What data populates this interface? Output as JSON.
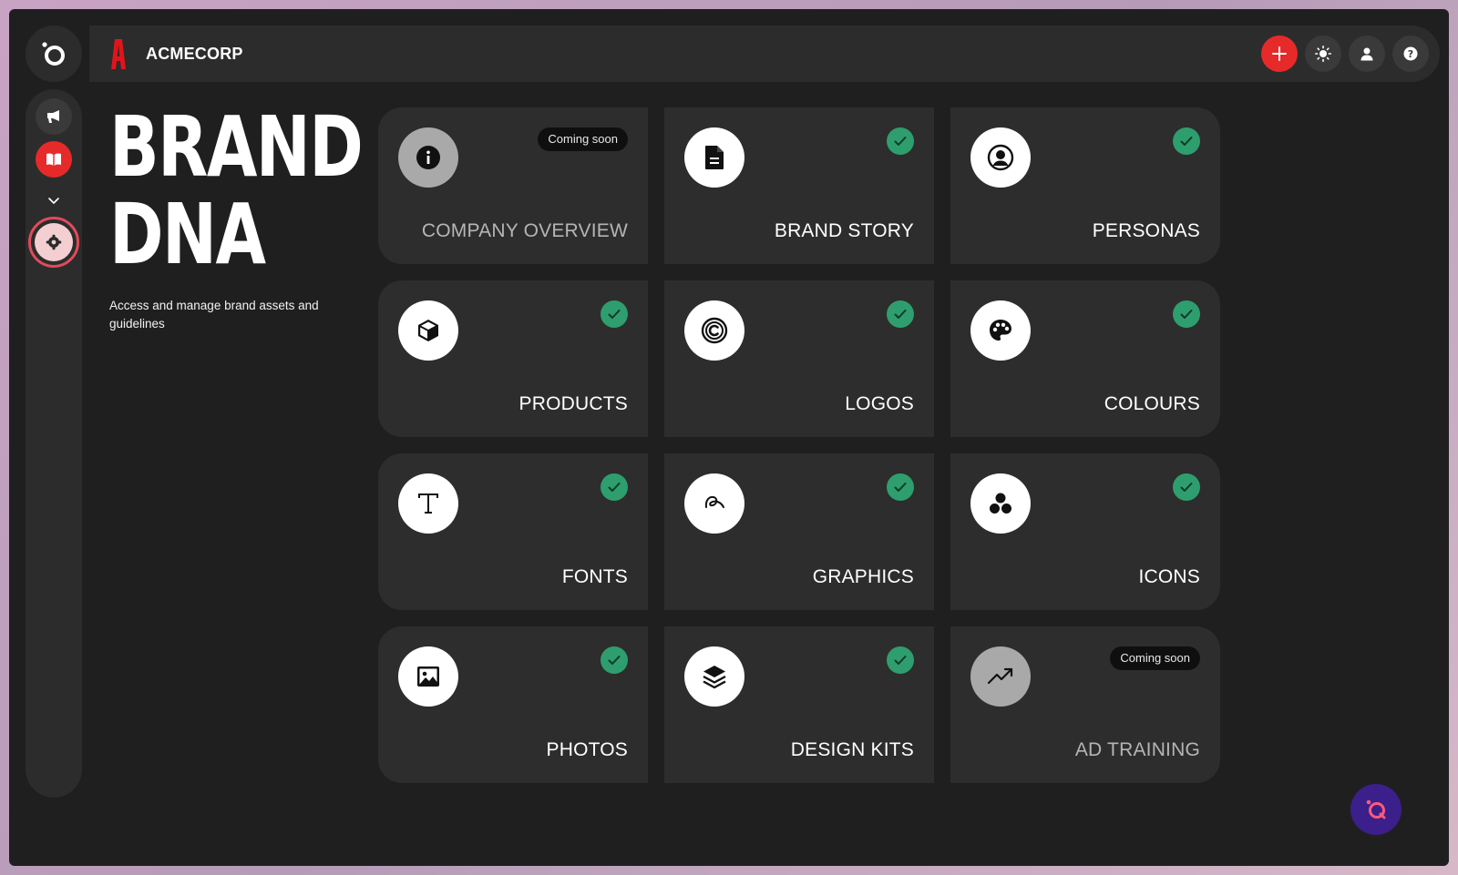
{
  "header": {
    "brand_name": "ACMECORP"
  },
  "page": {
    "title_line1": "BRAND",
    "title_line2": "DNA",
    "description": "Access and manage brand assets and guidelines"
  },
  "cards": [
    {
      "label": "COMPANY OVERVIEW",
      "icon": "info-icon",
      "status": "coming-soon",
      "badge": "Coming soon"
    },
    {
      "label": "BRAND STORY",
      "icon": "document-icon",
      "status": "complete"
    },
    {
      "label": "PERSONAS",
      "icon": "user-circle-icon",
      "status": "complete"
    },
    {
      "label": "PRODUCTS",
      "icon": "box-icon",
      "status": "complete"
    },
    {
      "label": "LOGOS",
      "icon": "copyright-icon",
      "status": "complete"
    },
    {
      "label": "COLOURS",
      "icon": "palette-icon",
      "status": "complete"
    },
    {
      "label": "FONTS",
      "icon": "type-icon",
      "status": "complete"
    },
    {
      "label": "GRAPHICS",
      "icon": "squiggle-icon",
      "status": "complete"
    },
    {
      "label": "ICONS",
      "icon": "shapes-icon",
      "status": "complete"
    },
    {
      "label": "PHOTOS",
      "icon": "image-icon",
      "status": "complete"
    },
    {
      "label": "DESIGN KITS",
      "icon": "layers-icon",
      "status": "complete"
    },
    {
      "label": "AD TRAINING",
      "icon": "trending-up-icon",
      "status": "coming-soon",
      "badge": "Coming soon"
    }
  ],
  "colors": {
    "accent_red": "#e62a2a",
    "check_green": "#2e9e6e",
    "card_bg": "#2d2d2d",
    "app_bg": "#1f1f1f",
    "chat_purple": "#3b1f8a"
  }
}
